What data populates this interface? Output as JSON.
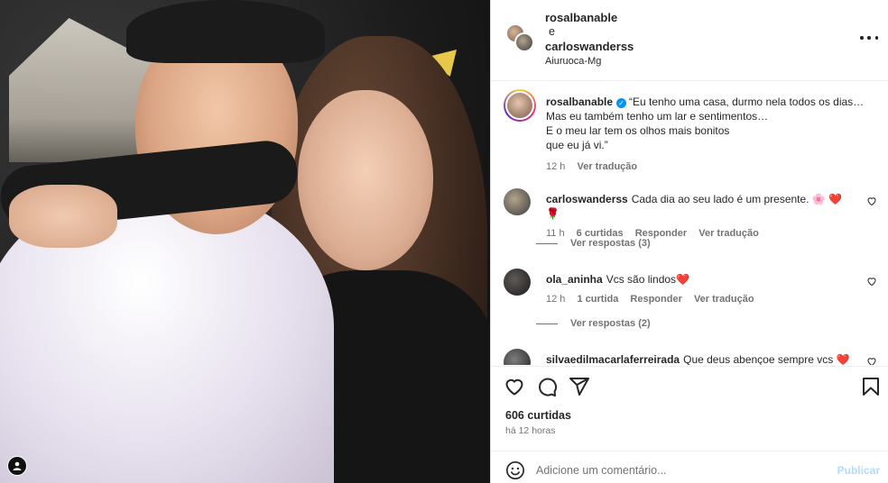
{
  "header": {
    "user1": "rosalbanable",
    "conjunction": "e",
    "user2": "carloswanderss",
    "location": "Aiuruoca-Mg"
  },
  "caption": {
    "username": "rosalbanable",
    "verified": true,
    "lines": [
      "“Eu tenho uma casa, durmo nela todos os dias…",
      "Mas eu também tenho um lar e sentimentos…",
      "E o meu lar tem os olhos mais bonitos",
      "que eu já vi.”"
    ],
    "time": "12 h",
    "translate": "Ver tradução"
  },
  "comments": [
    {
      "username": "carloswanderss",
      "text": "Cada dia ao seu lado é um presente. 🌸 ❤️ 🌹",
      "time": "11 h",
      "likes": "6 curtidas",
      "reply": "Responder",
      "translate": "Ver tradução",
      "view_replies": "Ver respostas (3)"
    },
    {
      "username": "ola_aninha",
      "text": "Vcs são lindos❤️",
      "time": "12 h",
      "likes": "1 curtida",
      "reply": "Responder",
      "translate": "Ver tradução",
      "view_replies": "Ver respostas (2)"
    },
    {
      "username": "silvaedilmacarlaferreirada",
      "text": "Que deus abençoe sempre vcs ❤️"
    }
  ],
  "actions": {
    "icons": [
      "heart-icon",
      "comment-icon",
      "share-icon",
      "bookmark-icon"
    ]
  },
  "likes": "606 curtidas",
  "posted": "há 12 horas",
  "add_comment": {
    "placeholder": "Adicione um comentário...",
    "post_label": "Publicar"
  },
  "colors": {
    "verified": "#0095f6",
    "post_disabled": "#b3dbff",
    "heart": "#ed4956"
  }
}
